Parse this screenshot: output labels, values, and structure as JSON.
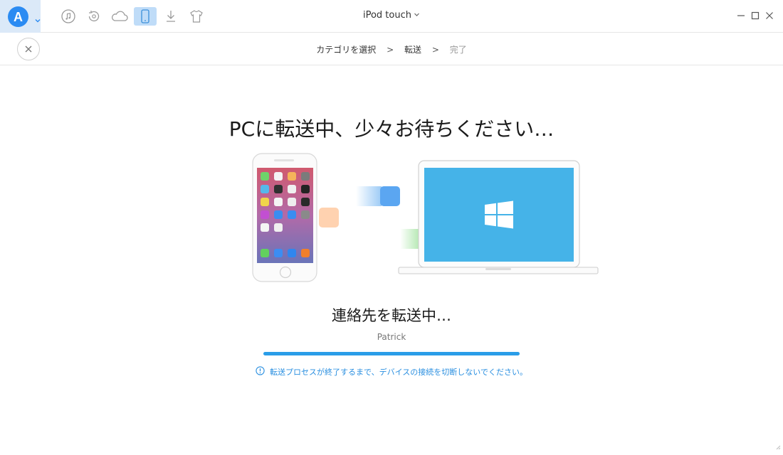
{
  "titlebar": {
    "device_name": "iPod touch",
    "toolbar_icons": [
      "music-icon",
      "history-icon",
      "cloud-icon",
      "device-icon",
      "download-icon",
      "shirt-icon"
    ],
    "active_icon": "device-icon"
  },
  "breadcrumb": {
    "steps": [
      "カテゴリを選択",
      "転送",
      "完了"
    ],
    "separator": ">"
  },
  "main": {
    "headline": "PCに転送中、少々お待ちください…",
    "status": "連絡先を転送中…",
    "current_item": "Patrick",
    "progress": 1.0,
    "warning": "転送プロセスが終了するまで、デバイスの接続を切断しないでください。"
  },
  "colors": {
    "accent": "#2a9de8",
    "logo": "#2b8bf2",
    "active_tab": "#bfdcf8",
    "laptop_screen": "#45b3e8"
  }
}
